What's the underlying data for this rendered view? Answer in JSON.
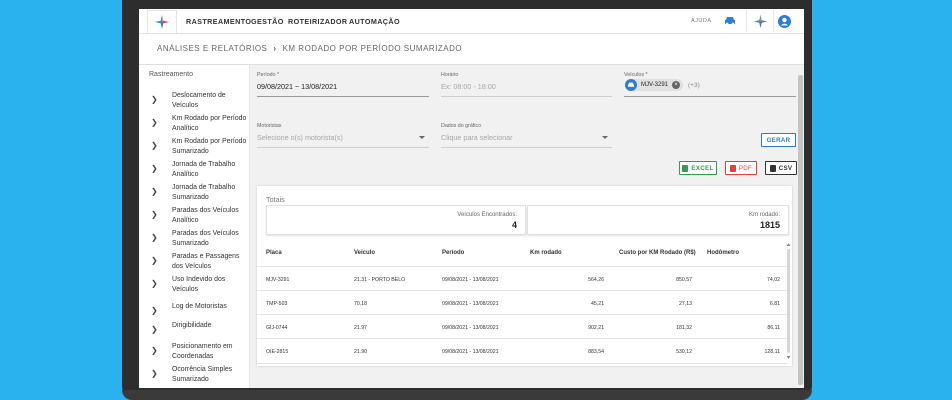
{
  "nav": {
    "items": [
      "RASTREAMENTO",
      "GESTÃO",
      "ROTEIRIZADOR",
      "AUTOMAÇÃO"
    ],
    "help": "AJUDA"
  },
  "breadcrumb": {
    "section": "ANÁLISES E RELATÓRIOS",
    "page": "KM RODADO POR PERÍODO SUMARIZADO"
  },
  "sidebar": {
    "title": "Rastreamento",
    "items": [
      {
        "label": "Deslocamento de Veículos"
      },
      {
        "label": "Km Rodado por Período Analítico"
      },
      {
        "label": "Km Rodado por Período Sumarizado"
      },
      {
        "label": "Jornada de Trabalho Analítico"
      },
      {
        "label": "Jornada de Trabalho Sumarizado"
      },
      {
        "label": "Paradas dos Veículos Analítico"
      },
      {
        "label": "Paradas dos Veículos Sumarizado"
      },
      {
        "label": "Paradas e Passagens dos Veículos"
      },
      {
        "label": "Uso Indevido dos Veículos"
      },
      {
        "label": "Log de Motoristas"
      },
      {
        "label": "Dirigibilidade"
      },
      {
        "label": "Posicionamento em Coordenadas"
      },
      {
        "label": "Ocorrência Simples Sumarizado"
      }
    ]
  },
  "filters": {
    "periodo": {
      "label": "Período *",
      "value": "09/08/2021 ~ 13/08/2021"
    },
    "horario": {
      "label": "Horário",
      "placeholder": "Ex: 08:00 - 18:00"
    },
    "veiculos": {
      "label": "Veículos *",
      "chip": "MJV-3291",
      "extra": "(+3)"
    },
    "motoristas": {
      "label": "Motoristas",
      "placeholder": "Selecione o(s) motorista(s)"
    },
    "dados": {
      "label": "Dados do gráfico",
      "placeholder": "Clique para selecionar"
    },
    "gerar": "GERAR"
  },
  "exports": {
    "excel": "EXCEL",
    "pdf": "PDF",
    "csv": "CSV"
  },
  "colors": {
    "accent": "#2a7fd4",
    "excel": "#2e9e4f",
    "pdf": "#e0413b",
    "csv": "#333333"
  },
  "totals": {
    "title": "Totais",
    "veiculos_label": "Veículos Encontrados:",
    "veiculos_value": "4",
    "km_label": "Km rodado:",
    "km_value": "1815"
  },
  "table": {
    "headers": [
      "Placa",
      "Veículo",
      "Período",
      "Km rodado",
      "Custo por KM Rodado (R$)",
      "Hodômetro"
    ],
    "rows": [
      [
        "MJV-3291",
        "21.31 - PORTO BELO",
        "09/08/2021 - 13/08/2021",
        "564,26",
        "850,57",
        "74,02"
      ],
      [
        "TMP-503",
        "70.18",
        "09/08/2021 - 13/08/2021",
        "45,21",
        "27,13",
        "6,81"
      ],
      [
        "GIJ-0744",
        "21.97",
        "09/08/2021 - 13/08/2021",
        "902,21",
        "181,32",
        "86,11"
      ],
      [
        "OIE-2815",
        "21.90",
        "09/08/2021 - 13/08/2021",
        "883,54",
        "530,12",
        "128,11"
      ]
    ]
  }
}
